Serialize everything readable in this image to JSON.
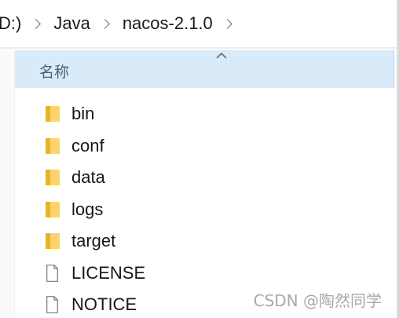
{
  "breadcrumb": {
    "drive_label": "D:)",
    "items": [
      "Java",
      "nacos-2.1.0"
    ]
  },
  "header": {
    "name_column": "名称"
  },
  "files": [
    {
      "name": "bin",
      "type": "folder"
    },
    {
      "name": "conf",
      "type": "folder"
    },
    {
      "name": "data",
      "type": "folder"
    },
    {
      "name": "logs",
      "type": "folder"
    },
    {
      "name": "target",
      "type": "folder"
    },
    {
      "name": "LICENSE",
      "type": "file"
    },
    {
      "name": "NOTICE",
      "type": "file"
    }
  ],
  "watermark": "CSDN @陶然同学",
  "colors": {
    "header_bg": "#d9ebf9",
    "folder_main": "#fcd46b",
    "folder_back": "#e9b326"
  }
}
